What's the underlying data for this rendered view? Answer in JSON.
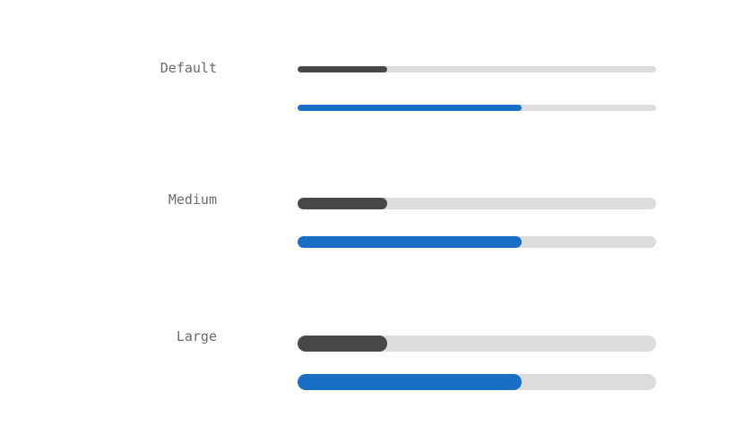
{
  "colors": {
    "track": "#dcdcdc",
    "neutral_fill": "#474747",
    "accent_fill": "#1a6fc4",
    "label_text": "#6b6b6b",
    "background": "#ffffff"
  },
  "sizes": [
    {
      "label": "Default",
      "bars": [
        {
          "variant": "neutral",
          "progress": 0.25
        },
        {
          "variant": "accent",
          "progress": 0.625
        }
      ]
    },
    {
      "label": "Medium",
      "bars": [
        {
          "variant": "neutral",
          "progress": 0.25
        },
        {
          "variant": "accent",
          "progress": 0.625
        }
      ]
    },
    {
      "label": "Large",
      "bars": [
        {
          "variant": "neutral",
          "progress": 0.25
        },
        {
          "variant": "accent",
          "progress": 0.625
        }
      ]
    }
  ]
}
